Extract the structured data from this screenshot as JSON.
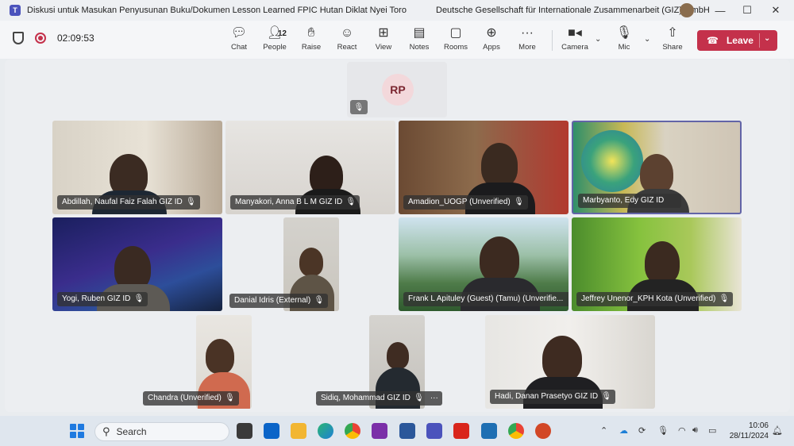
{
  "window": {
    "title": "Diskusi untuk Masukan Penyusunan Buku/Dokumen Lesson Learned FPIC Hutan Diklat Nyei Toro",
    "organization": "Deutsche Gesellschaft für Internationale Zusammenarbeit (GIZ) GmbH",
    "controls": [
      "—",
      "☐",
      "✕"
    ]
  },
  "toolbar": {
    "timer": "02:09:53",
    "people_count": "12",
    "buttons": [
      {
        "label": "Chat",
        "icon": "chat-icon"
      },
      {
        "label": "People",
        "icon": "people-icon"
      },
      {
        "label": "Raise",
        "icon": "hand-icon"
      },
      {
        "label": "React",
        "icon": "smile-icon"
      },
      {
        "label": "View",
        "icon": "grid-icon"
      },
      {
        "label": "Notes",
        "icon": "notes-icon"
      },
      {
        "label": "Rooms",
        "icon": "rooms-icon"
      },
      {
        "label": "Apps",
        "icon": "apps-icon"
      },
      {
        "label": "More",
        "icon": "more-icon"
      },
      {
        "label": "Camera",
        "icon": "camera-icon"
      },
      {
        "label": "Mic",
        "icon": "mic-off-icon"
      },
      {
        "label": "Share",
        "icon": "share-icon"
      }
    ],
    "leave_label": "Leave",
    "leave_color": "#c4314b"
  },
  "stage": {
    "top_participant": {
      "initials": "RP"
    },
    "participants": [
      {
        "name": "Abdillah, Naufal Faiz Falah GIZ ID"
      },
      {
        "name": "Manyakori, Anna B L M GIZ ID"
      },
      {
        "name": "Amadion_UOGP (Unverified)"
      },
      {
        "name": "Marbyanto, Edy GIZ ID"
      },
      {
        "name": "Yogi, Ruben GIZ ID"
      },
      {
        "name": "Danial Idris (External)"
      },
      {
        "name": "Frank L Apituley (Guest) (Tamu) (Unverifie..."
      },
      {
        "name": "Jeffrey Unenor_KPH Kota (Unverified)"
      },
      {
        "name": "Chandra (Unverified)"
      },
      {
        "name": "Sidiq, Mohammad GIZ ID"
      },
      {
        "name": "Hadi, Danan Prasetyo GIZ ID"
      }
    ],
    "active_speaker_color": "#6264a7"
  },
  "taskbar": {
    "search_placeholder": "Search",
    "time": "10:06",
    "date": "28/11/2024"
  }
}
